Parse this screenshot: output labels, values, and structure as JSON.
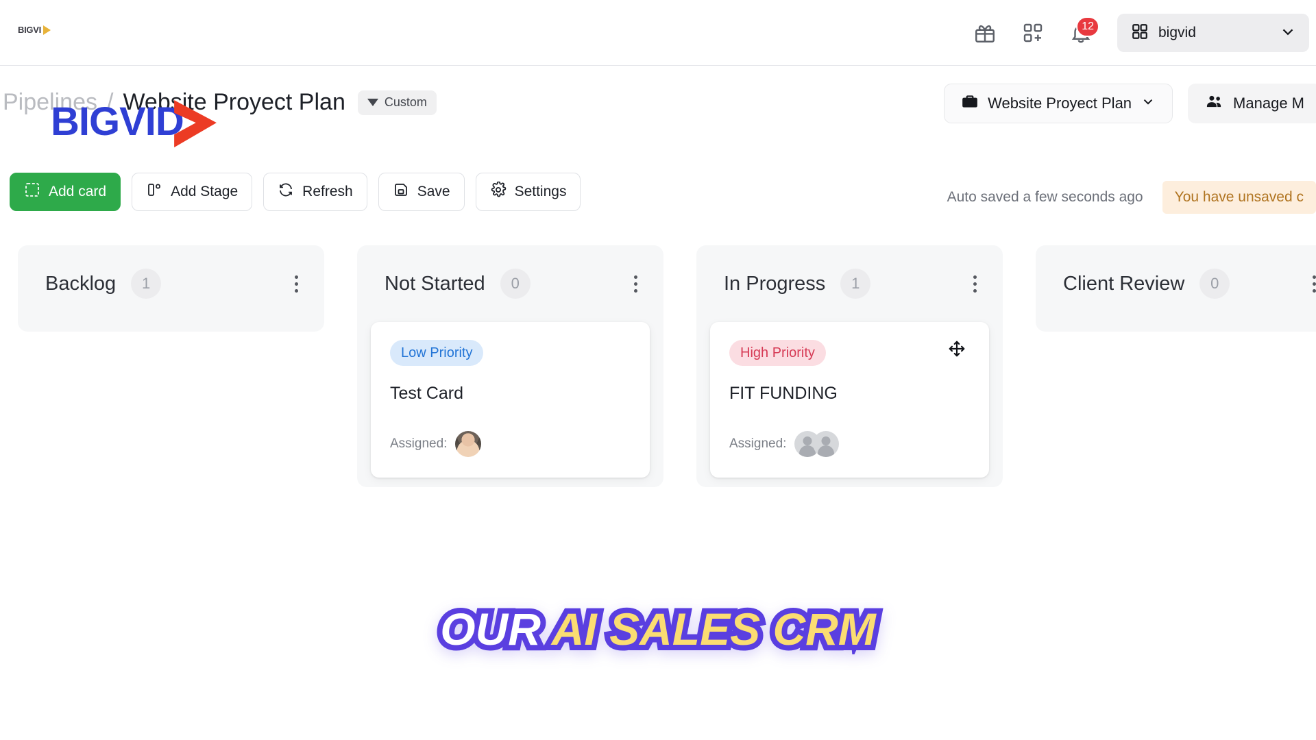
{
  "brand": {
    "logo_text": "BIGVI",
    "logo_icon": "play-triangle-icon"
  },
  "topnav": {
    "gift_icon": "gift-icon",
    "apps_icon": "grid-plus-icon",
    "bell_icon": "bell-icon",
    "notification_count": "12",
    "workspace": {
      "icon": "grid-icon",
      "label": "bigvid",
      "chevron": "chevron-down-icon"
    }
  },
  "header": {
    "breadcrumb_parent": "Pipelines",
    "breadcrumb_separator": "/",
    "breadcrumb_current": "Website Proyect Plan",
    "filter_badge": "Custom",
    "pipeline_selector": "Website Proyect Plan",
    "manage_members": "Manage M"
  },
  "toolbar": {
    "add_card": "Add card",
    "add_stage": "Add Stage",
    "refresh": "Refresh",
    "save": "Save",
    "settings": "Settings",
    "autosave_status": "Auto saved a few seconds ago",
    "unsaved_warning": "You have unsaved c"
  },
  "watermark": {
    "text": "BIGVID",
    "icon": "play-triangle-icon"
  },
  "banner": {
    "part1": "OUR ",
    "part2": "AI SALES CRM"
  },
  "colors": {
    "primary_green": "#2eaa4a",
    "badge_red": "#e8393f",
    "low_priority_bg": "#d9e9fb",
    "low_priority_fg": "#2274d6",
    "high_priority_bg": "#fbdde2",
    "high_priority_fg": "#d63a55",
    "warning_bg": "#fdeedd",
    "warning_fg": "#b07420",
    "banner_purple": "#5a3fe0",
    "banner_yellow": "#fbdd72",
    "watermark_blue": "#2f3fd4",
    "watermark_red": "#ec3b24"
  },
  "board": {
    "columns": [
      {
        "title": "Backlog",
        "count": "1",
        "cards": []
      },
      {
        "title": "Not Started",
        "count": "0",
        "cards": [
          {
            "priority": "Low Priority",
            "priority_level": "low",
            "title": "Test Card",
            "assigned_label": "Assigned:",
            "assignees": 1,
            "assignee_type": "photo",
            "draggable": false
          }
        ]
      },
      {
        "title": "In Progress",
        "count": "1",
        "cards": [
          {
            "priority": "High Priority",
            "priority_level": "high",
            "title": "FIT FUNDING",
            "assigned_label": "Assigned:",
            "assignees": 2,
            "assignee_type": "placeholder",
            "draggable": true
          }
        ]
      },
      {
        "title": "Client Review",
        "count": "0",
        "cards": []
      }
    ]
  }
}
